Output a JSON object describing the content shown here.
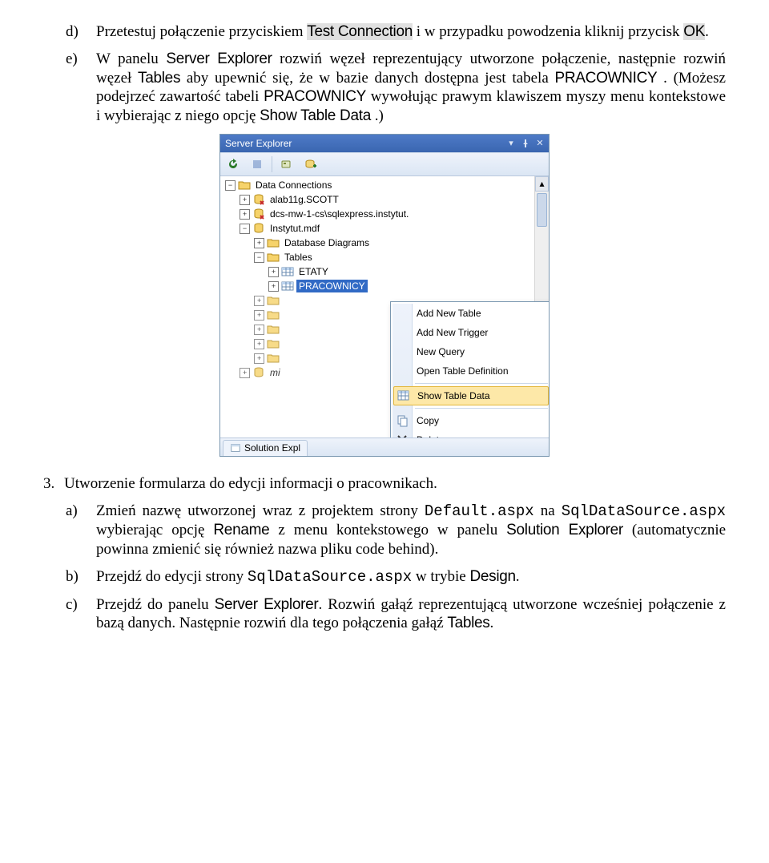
{
  "doc": {
    "d_prefix": "Przetestuj połączenie przyciskiem ",
    "d_btn": "Test Connection",
    "d_mid": " i w przypadku powodzenia kliknij przycisk ",
    "d_ok": "OK",
    "d_end": ".",
    "e_p1a": "W panelu ",
    "e_server_explorer": "Server Explorer",
    "e_p1b": " rozwiń węzeł reprezentujący utworzone połączenie, następnie rozwiń węzeł ",
    "e_tables": "Tables",
    "e_p1c": " aby upewnić się, że w bazie danych dostępna jest tabela ",
    "e_prac": "PRACOWNICY",
    "e_p1d": ". (Możesz podejrzeć zawartość tabeli ",
    "e_prac2": "PRACOWNICY",
    "e_p1e": " wywołując prawym klawiszem myszy menu kontekstowe i wybierając z niego opcję ",
    "e_show": "Show Table Data",
    "e_p1f": ".)",
    "h3": "Utworzenie formularza do edycji informacji o pracownikach.",
    "a_1": "Zmień nazwę utworzonej wraz z projektem strony ",
    "a_code1": "Default.aspx",
    "a_2": " na ",
    "a_code2": "SqlDataSource.aspx",
    "a_3": " wybierając opcję ",
    "a_rename": "Rename",
    "a_4": " z menu kontekstowego w panelu ",
    "a_sol": "Solution Explorer",
    "a_5": " (automatycznie powinna zmienić się również nazwa pliku code behind).",
    "b_1": "Przejdź do edycji strony ",
    "b_code": "SqlDataSource.aspx",
    "b_2": " w trybie ",
    "b_design": "Design",
    "b_3": ".",
    "c_1": "Przejdź do panelu ",
    "c_se": "Server Explorer",
    "c_2": ". Rozwiń gałąź reprezentującą utworzone wcześniej połączenie z bazą danych. Następnie rozwiń dla tego połączenia gałąź ",
    "c_tables": "Tables",
    "c_3": "."
  },
  "panel": {
    "title": "Server Explorer",
    "title_buttons": {
      "dropdown": "▾",
      "pin": "📌",
      "close": "✕"
    },
    "toolbar": [
      "refresh-icon",
      "stop-icon",
      "sep",
      "connect-server-icon",
      "add-connection-icon"
    ],
    "tree": [
      {
        "depth": 0,
        "toggle": "-",
        "icon": "folder",
        "label": "Data Connections"
      },
      {
        "depth": 1,
        "toggle": "+",
        "icon": "db-err",
        "label": "alab11g.SCOTT"
      },
      {
        "depth": 1,
        "toggle": "+",
        "icon": "db-err",
        "label": "dcs-mw-1-cs\\sqlexpress.instytut."
      },
      {
        "depth": 1,
        "toggle": "-",
        "icon": "db",
        "label": "Instytut.mdf"
      },
      {
        "depth": 2,
        "toggle": "+",
        "icon": "folder",
        "label": "Database Diagrams"
      },
      {
        "depth": 2,
        "toggle": "-",
        "icon": "folder",
        "label": "Tables"
      },
      {
        "depth": 3,
        "toggle": "+",
        "icon": "table",
        "label": "ETATY"
      },
      {
        "depth": 3,
        "toggle": "+",
        "icon": "table",
        "label": "PRACOWNICY",
        "selected": true
      },
      {
        "depth": 2,
        "toggle": "+",
        "icon": "folder",
        "label": "",
        "cut": true
      },
      {
        "depth": 2,
        "toggle": "+",
        "icon": "folder",
        "label": "",
        "cut": true
      },
      {
        "depth": 2,
        "toggle": "+",
        "icon": "folder",
        "label": "",
        "cut": true
      },
      {
        "depth": 2,
        "toggle": "+",
        "icon": "folder",
        "label": "",
        "cut": true
      },
      {
        "depth": 2,
        "toggle": "+",
        "icon": "folder",
        "label": "",
        "cut": true
      },
      {
        "depth": 1,
        "toggle": "+",
        "icon": "db",
        "label": "mi",
        "cut": true
      }
    ],
    "context_menu": [
      {
        "label": "Add New Table",
        "icon": ""
      },
      {
        "label": "Add New Trigger",
        "icon": ""
      },
      {
        "label": "New Query",
        "icon": ""
      },
      {
        "label": "Open Table Definition",
        "icon": ""
      },
      {
        "sep": true
      },
      {
        "label": "Show Table Data",
        "icon": "table-data",
        "hi": true
      },
      {
        "sep": true
      },
      {
        "label": "Copy",
        "icon": "copy"
      },
      {
        "label": "Delete",
        "icon": "delete"
      }
    ],
    "tab": "Solution Expl"
  }
}
